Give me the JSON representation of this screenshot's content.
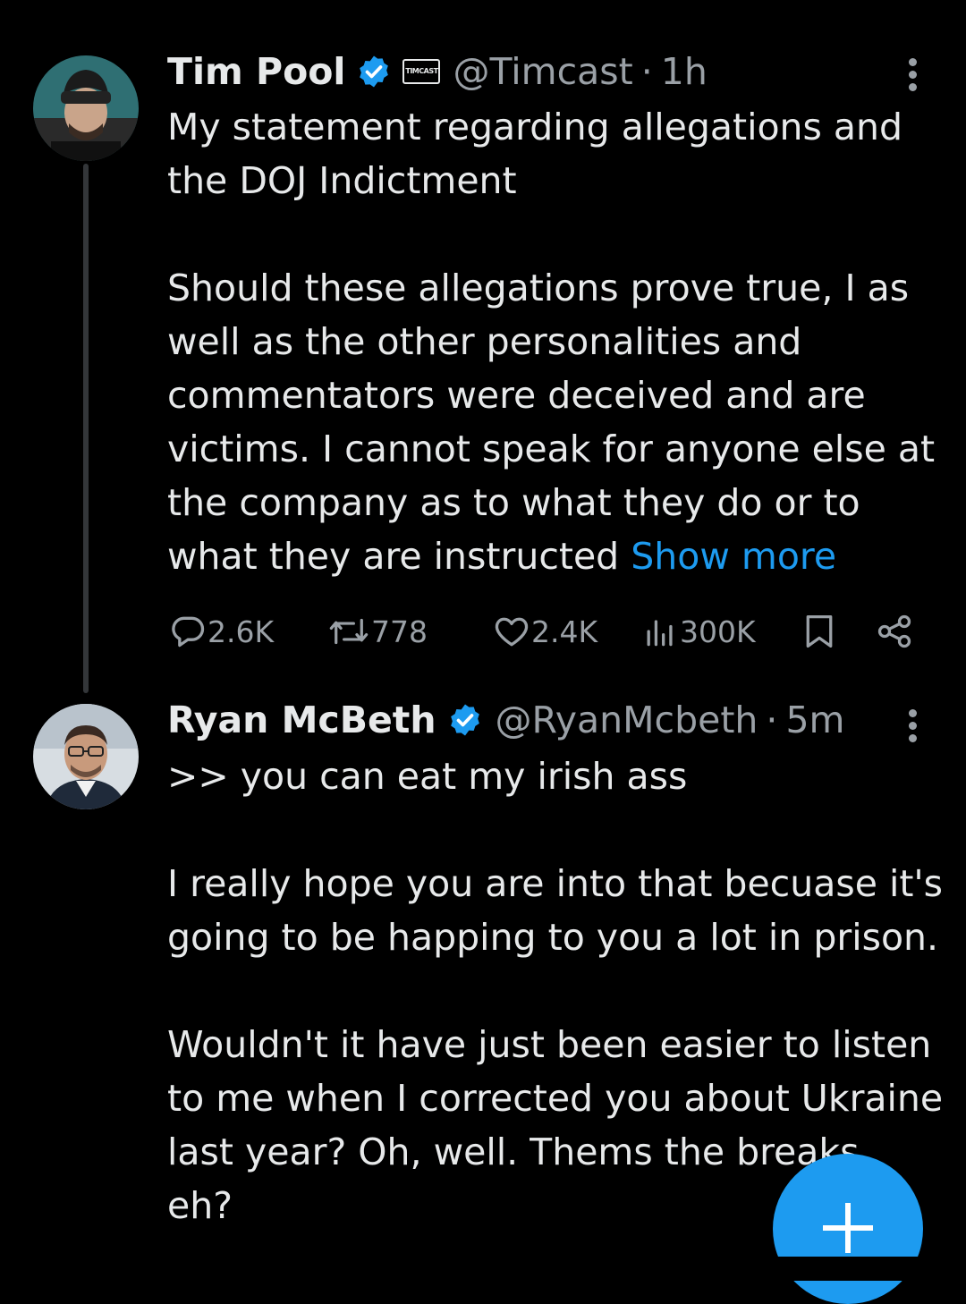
{
  "colors": {
    "background": "#000000",
    "text": "#e7e9ea",
    "muted": "#9aa0a6",
    "accent": "#1d9bf0",
    "thread_line": "#333639"
  },
  "tweets": [
    {
      "author_name": "Tim Pool",
      "verified_icon": "verified-badge-icon",
      "org_badge": "TIMCAST",
      "handle": "@Timcast",
      "separator": "·",
      "time": "1h",
      "paragraphs": [
        "My statement regarding allegations and\nthe DOJ Indictment",
        "Should these allegations prove true, I as\nwell as the other personalities and\ncommentators were deceived and are\nvictims. I cannot speak for anyone else at\nthe company as to what they do or to\nwhat they are instructed"
      ],
      "show_more": "Show more",
      "actions": {
        "replies": "2.6K",
        "reposts": "778",
        "likes": "2.4K",
        "views": "300K"
      }
    },
    {
      "author_name": "Ryan McBeth",
      "verified_icon": "verified-badge-icon",
      "handle": "@RyanMcbeth",
      "separator": "·",
      "time": "5m",
      "paragraphs": [
        ">> you can eat my irish ass",
        "I really hope you are into that becuase it's\ngoing to be happing to you a lot in prison.",
        "Wouldn't it have just been easier to listen\nto me when I corrected you about Ukraine\nlast year?  Oh, well. Thems the breaks\neh?"
      ]
    }
  ],
  "fab": {
    "icon": "plus-icon"
  }
}
